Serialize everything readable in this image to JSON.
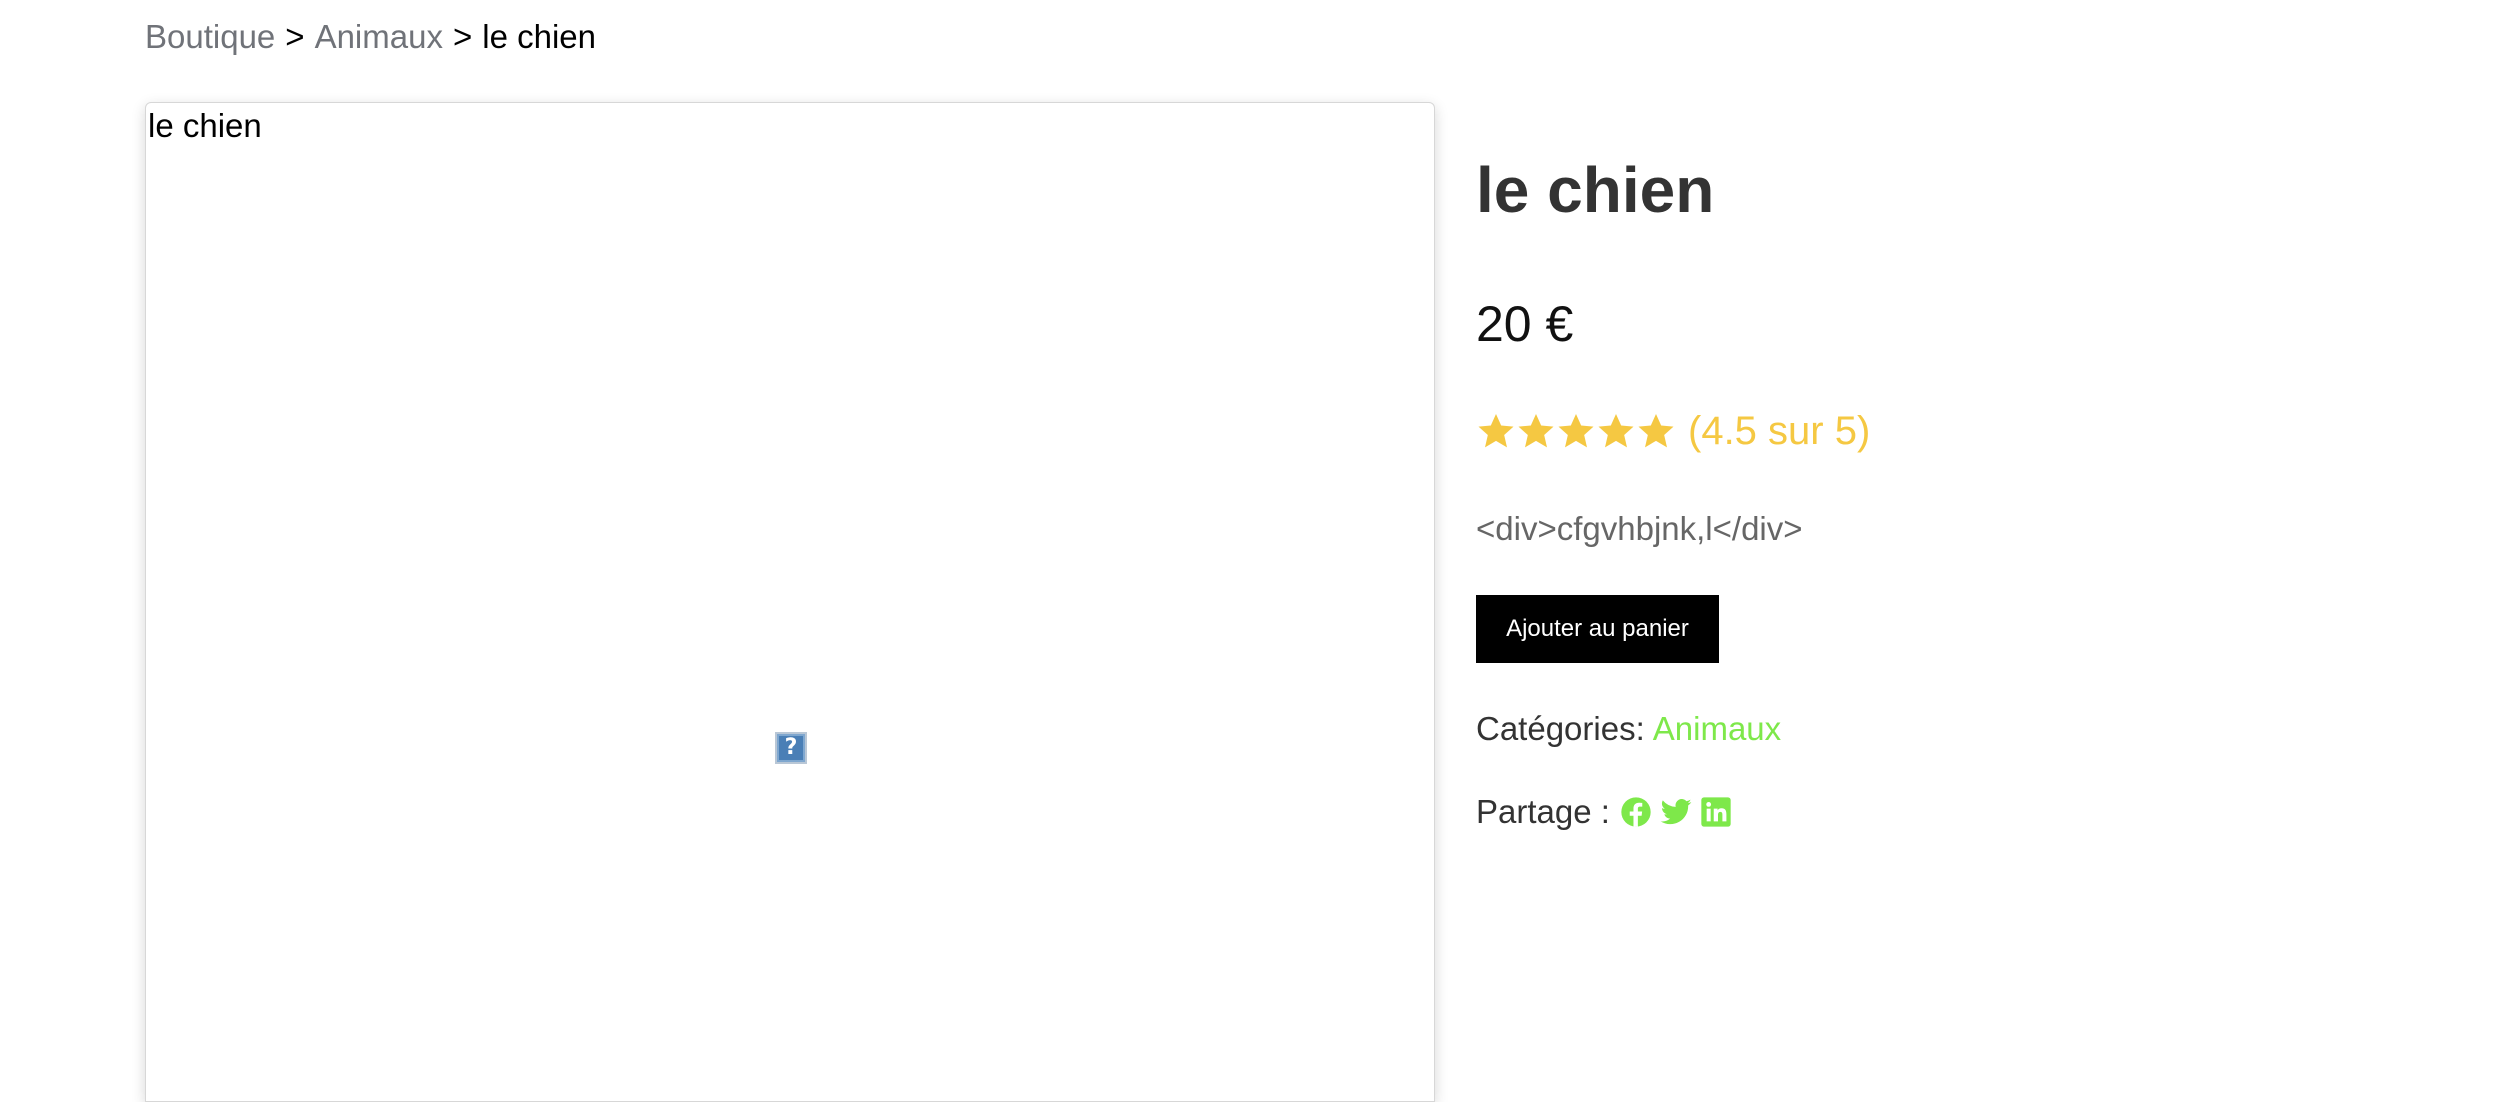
{
  "breadcrumb": {
    "items": [
      {
        "label": "Boutique"
      },
      {
        "label": "Animaux"
      }
    ],
    "separator": ">",
    "current": "le chien"
  },
  "product_image": {
    "alt_text": "le chien",
    "broken_icon_glyph": "?",
    "icon": "broken-image-icon"
  },
  "product": {
    "title": "le chien",
    "price": "20 €",
    "rating": {
      "value": 4.5,
      "max": 5,
      "label": "(4.5 sur 5)",
      "star_color": "#f5c842",
      "icon": "star-icon"
    },
    "description": "<div>cfgvhbjnk,l</div>",
    "add_to_cart_label": "Ajouter au panier",
    "categories_label": "Catégories:",
    "category": "Animaux",
    "share_label": "Partage :",
    "share_icons": [
      "facebook-icon",
      "twitter-icon",
      "linkedin-icon"
    ]
  },
  "colors": {
    "accent_green": "#7ee84a",
    "link_gray": "#707379",
    "button_bg": "#000000",
    "button_text": "#ffffff"
  }
}
